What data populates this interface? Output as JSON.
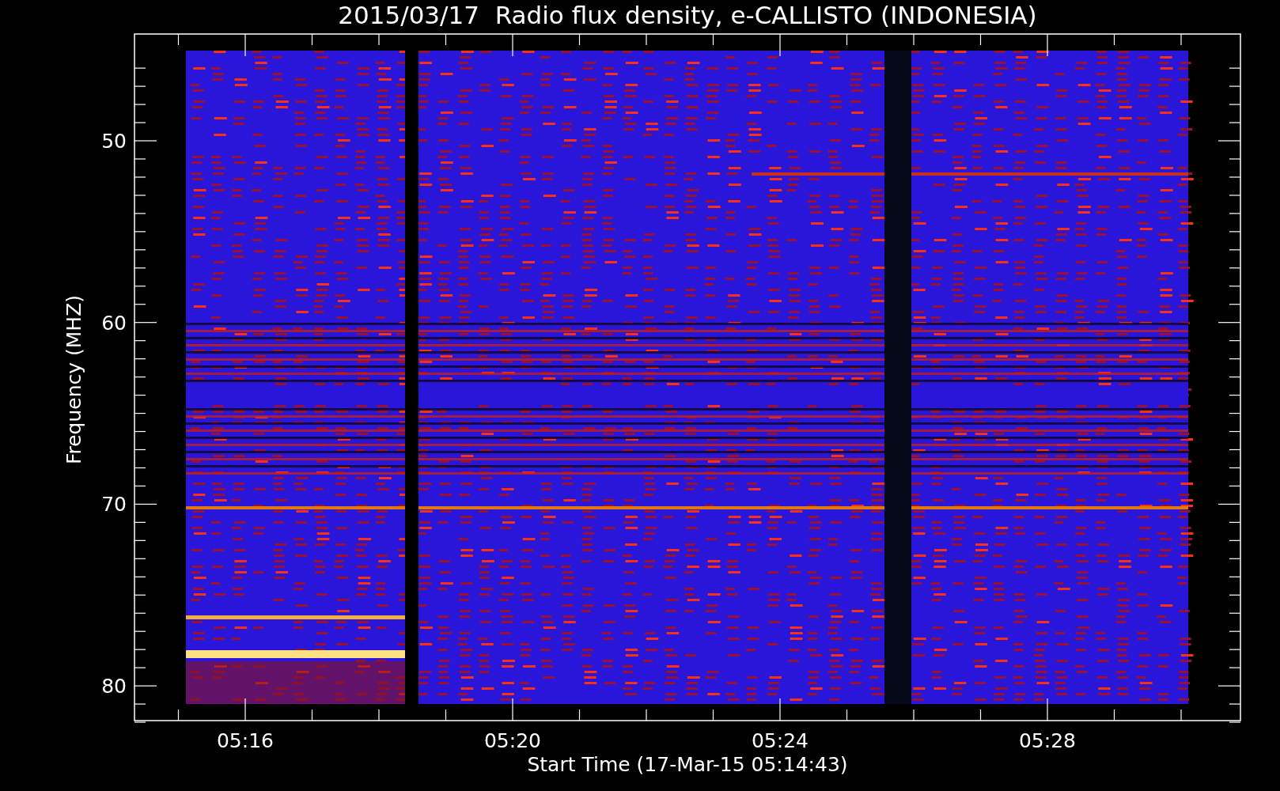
{
  "title": "2015/03/17  Radio flux density, e-CALLISTO (INDONESIA)",
  "y_axis": {
    "label": "Frequency (MHZ)",
    "ticks": [
      "50",
      "60",
      "70",
      "80"
    ]
  },
  "x_axis": {
    "label": "Start Time (17-Mar-15 05:14:43)",
    "ticks": [
      "05:16",
      "05:20",
      "05:24",
      "05:28"
    ]
  }
}
